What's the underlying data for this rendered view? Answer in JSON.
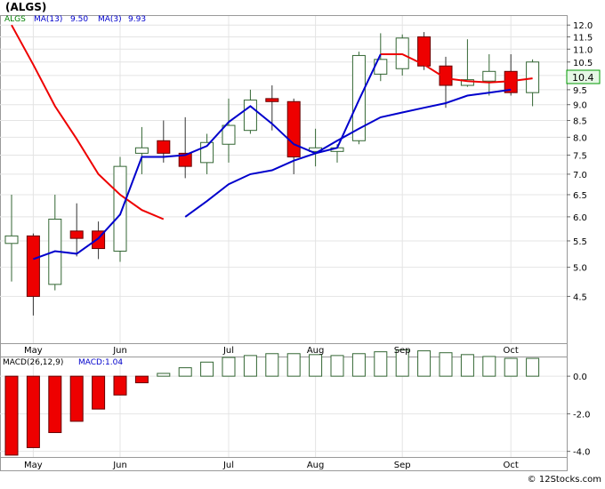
{
  "chart_data": [
    {
      "type": "candlestick",
      "ticker_label": "(ALGS)",
      "legend": [
        {
          "label": "ALGS",
          "color": "#008000"
        },
        {
          "label": "MA(13)",
          "value": "9.50",
          "color": "#0000cc"
        },
        {
          "label": "MA(3)",
          "value": "9.93",
          "color": "#0000cc"
        }
      ],
      "last_price_label": "10.4",
      "y_ticks": [
        "12.0",
        "11.5",
        "11.0",
        "10.5",
        "10.0",
        "9.5",
        "9.0",
        "8.5",
        "8.0",
        "7.5",
        "7.0",
        "6.5",
        "6.0",
        "5.5",
        "5.0",
        "4.5"
      ],
      "ylim": [
        3.8,
        12.4
      ],
      "y_scale": "log",
      "month_labels": [
        {
          "label": "May",
          "index": 1
        },
        {
          "label": "Jun",
          "index": 5
        },
        {
          "label": "Jul",
          "index": 10
        },
        {
          "label": "Aug",
          "index": 14
        },
        {
          "label": "Sep",
          "index": 18
        },
        {
          "label": "Oct",
          "index": 23
        }
      ],
      "candles": [
        {
          "open": 5.45,
          "high": 6.5,
          "low": 4.75,
          "close": 5.6
        },
        {
          "open": 5.6,
          "high": 5.65,
          "low": 4.2,
          "close": 4.5
        },
        {
          "open": 4.7,
          "high": 6.5,
          "low": 4.6,
          "close": 5.95
        },
        {
          "open": 5.7,
          "high": 6.3,
          "low": 5.2,
          "close": 5.55
        },
        {
          "open": 5.7,
          "high": 5.9,
          "low": 5.15,
          "close": 5.35
        },
        {
          "open": 5.3,
          "high": 7.45,
          "low": 5.1,
          "close": 7.2
        },
        {
          "open": 7.55,
          "high": 8.3,
          "low": 7.0,
          "close": 7.7
        },
        {
          "open": 7.9,
          "high": 8.5,
          "low": 7.3,
          "close": 7.55
        },
        {
          "open": 7.55,
          "high": 8.6,
          "low": 6.9,
          "close": 7.2
        },
        {
          "open": 7.3,
          "high": 8.1,
          "low": 7.0,
          "close": 7.85
        },
        {
          "open": 7.8,
          "high": 9.2,
          "low": 7.3,
          "close": 8.35
        },
        {
          "open": 8.2,
          "high": 9.5,
          "low": 8.1,
          "close": 9.15
        },
        {
          "open": 9.2,
          "high": 9.65,
          "low": 8.2,
          "close": 9.1
        },
        {
          "open": 9.1,
          "high": 9.2,
          "low": 7.0,
          "close": 7.45
        },
        {
          "open": 7.6,
          "high": 8.25,
          "low": 7.2,
          "close": 7.7
        },
        {
          "open": 7.6,
          "high": 7.8,
          "low": 7.3,
          "close": 7.7
        },
        {
          "open": 7.9,
          "high": 10.9,
          "low": 7.8,
          "close": 10.75
        },
        {
          "open": 10.05,
          "high": 11.65,
          "low": 9.8,
          "close": 10.6
        },
        {
          "open": 10.25,
          "high": 11.6,
          "low": 10.0,
          "close": 11.45
        },
        {
          "open": 11.5,
          "high": 11.7,
          "low": 10.2,
          "close": 10.35
        },
        {
          "open": 10.35,
          "high": 10.7,
          "low": 8.9,
          "close": 9.65
        },
        {
          "open": 9.65,
          "high": 11.4,
          "low": 9.6,
          "close": 9.85
        },
        {
          "open": 9.8,
          "high": 10.8,
          "low": 9.3,
          "close": 10.15
        },
        {
          "open": 10.15,
          "high": 10.8,
          "low": 9.3,
          "close": 9.4
        },
        {
          "open": 9.4,
          "high": 10.6,
          "low": 8.95,
          "close": 10.5
        }
      ],
      "ma_red": [
        12.0,
        10.4,
        8.95,
        7.95,
        7.0,
        6.5,
        6.15,
        5.95,
        null,
        null,
        null,
        null,
        null,
        null,
        null,
        null,
        null,
        10.8,
        10.8,
        10.4,
        9.9,
        9.8,
        9.75,
        9.8,
        9.9
      ],
      "ma_blue": [
        null,
        5.15,
        5.3,
        5.25,
        5.55,
        6.05,
        7.45,
        7.45,
        7.5,
        7.75,
        8.45,
        8.95,
        8.4,
        7.8,
        7.55,
        7.7,
        9.15,
        10.8,
        null,
        null,
        null,
        null,
        null,
        null,
        null
      ],
      "ma_blue_tail": [
        null,
        null,
        null,
        null,
        null,
        null,
        null,
        null,
        6.0,
        6.35,
        6.75,
        7.0,
        7.1,
        7.35,
        7.55,
        7.9,
        8.25,
        8.6,
        8.75,
        8.9,
        9.05,
        9.3,
        9.4,
        9.5,
        null
      ]
    },
    {
      "type": "bar",
      "title": "MACD(26,12,9)",
      "legend": [
        {
          "label": "MACD:1.04",
          "color": "#0000cc"
        }
      ],
      "y_ticks": [
        "0.0",
        "-2.0",
        "-4.0"
      ],
      "ylim": [
        -4.3,
        1.0
      ],
      "values": [
        -4.2,
        -3.8,
        -3.0,
        -2.4,
        -1.75,
        -1.0,
        -0.35,
        0.15,
        0.45,
        0.75,
        1.0,
        1.1,
        1.2,
        1.2,
        1.15,
        1.1,
        1.2,
        1.3,
        1.4,
        1.35,
        1.25,
        1.15,
        1.05,
        0.95,
        0.95
      ]
    }
  ],
  "watermark": "© 12Stocks.com"
}
